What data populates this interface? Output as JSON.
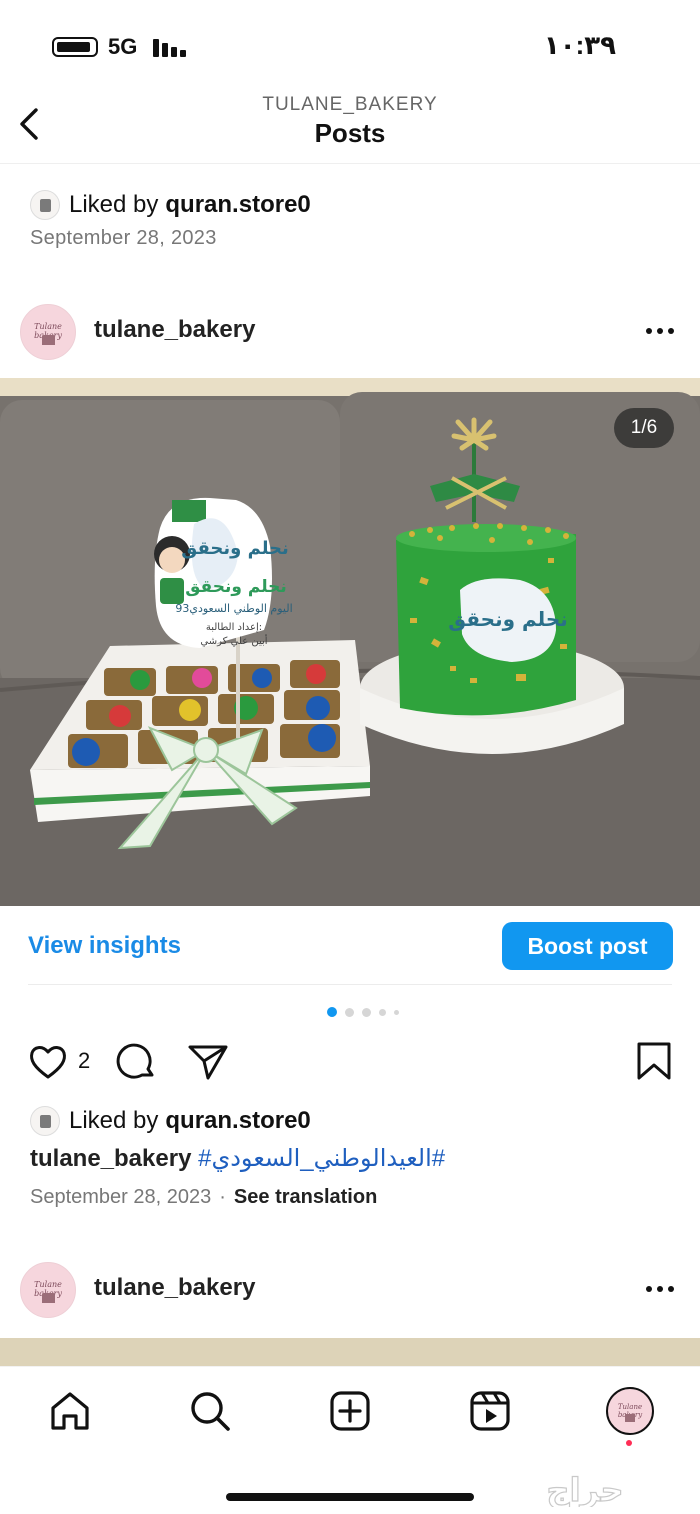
{
  "status_bar": {
    "network": "5G",
    "time": "١٠:٣٩"
  },
  "header": {
    "username": "TULANE_BAKERY",
    "title": "Posts"
  },
  "previous_post": {
    "liked_prefix": "Liked by",
    "liked_user": "quran.store0",
    "date": "September 28, 2023"
  },
  "post": {
    "username": "tulane_bakery",
    "avatar_text": "Tulane bakery",
    "image_counter": "1/6",
    "insights_label": "View insights",
    "boost_label": "Boost post",
    "likes_count": "2",
    "liked_prefix": "Liked by",
    "liked_user": "quran.store0",
    "caption_user": "tulane_bakery",
    "caption_hashtag": "#العيدالوطني_السعودي#",
    "date": "September 28, 2023",
    "date_separator": "·",
    "translate_label": "See translation",
    "carousel_active": 1,
    "carousel_total": 5,
    "photo_texts": {
      "sign_title": "نحلم ونحقق",
      "sign_line": "اليوم الوطني السعودي93",
      "sign_credit_1": "إعداد الطالبة:",
      "sign_credit_2": "أبين علي كرشي",
      "cake_logo": "نحلم ونحقق"
    }
  },
  "next_post": {
    "username": "tulane_bakery"
  },
  "tab_bar": {
    "items": [
      "home",
      "search",
      "create",
      "reels",
      "profile"
    ]
  },
  "watermark": "حراج",
  "colors": {
    "link_blue": "#1a8be6",
    "button_blue": "#1197f0",
    "saudi_green": "#2fa33c",
    "notification": "#ff2d55"
  }
}
